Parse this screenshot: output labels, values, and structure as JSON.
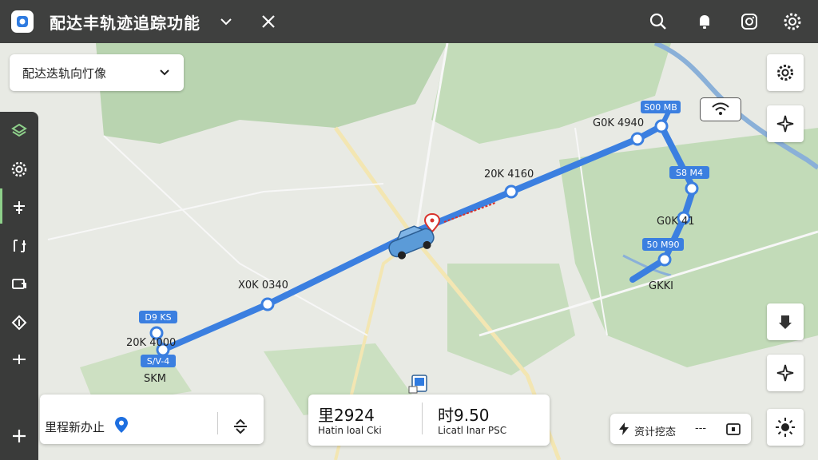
{
  "app": {
    "title": "配达丰轨迹追踪功能",
    "icons": [
      "app-logo-icon",
      "chevron-down-icon",
      "close-icon",
      "search-icon",
      "bell-icon",
      "camera-icon",
      "gear-icon"
    ]
  },
  "panel": {
    "dropdown_label": "配达迭轨向忊像"
  },
  "left_rail": {
    "items": [
      "layers-icon",
      "settings-cog-icon",
      "route-icon",
      "swap-icon",
      "screen-icon",
      "compass-icon",
      "divider-icon",
      "plus-icon"
    ]
  },
  "right_controls": [
    "settings-gear-icon",
    "locate-star-icon",
    "download-icon",
    "sparkle-icon",
    "sun-icon"
  ],
  "map": {
    "waypoints": [
      {
        "tag": "D9 KS",
        "label": "20K 4000"
      },
      {
        "tag": "S/V-4",
        "label": "SKM"
      },
      {
        "tag": "",
        "label": "X0K 0340"
      },
      {
        "tag": "",
        "label": "20K 4160"
      },
      {
        "tag": "S00 MB",
        "label": "G0K 4940"
      },
      {
        "tag": "S8 M4",
        "label": "G0K 41"
      },
      {
        "tag": "50 M90",
        "label": "GKKI"
      }
    ],
    "route_color": "#3b7fe0",
    "wifi_icon": "wifi-icon"
  },
  "stats": {
    "left_label": "里程新办止",
    "distance_value": "里2924",
    "distance_sub": "Hatin loal Cki",
    "time_value": "时9.50",
    "time_sub": "Licatl lnar PSC"
  },
  "status": {
    "text": "资计挖态",
    "trailing": "---"
  },
  "colors": {
    "topbar": "#3f403f",
    "route": "#3b7fe0",
    "active_rail": "#8ed08a",
    "pin": "#1e6fe0"
  }
}
